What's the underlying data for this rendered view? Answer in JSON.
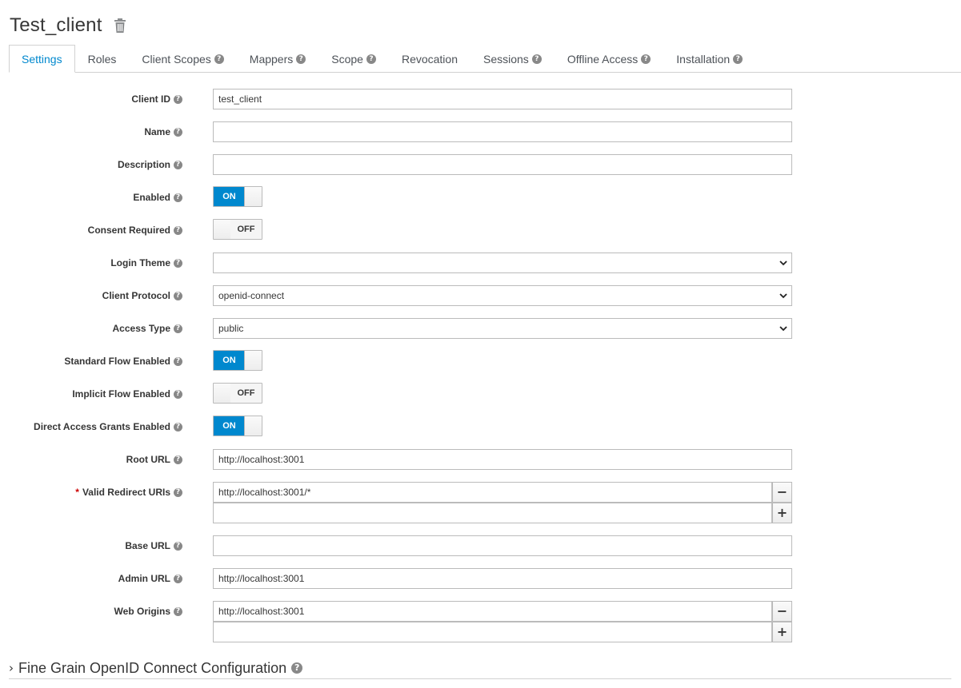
{
  "header": {
    "title": "Test_client",
    "delete_icon": "trash-icon"
  },
  "tabs": [
    {
      "label": "Settings",
      "help": false
    },
    {
      "label": "Roles",
      "help": false
    },
    {
      "label": "Client Scopes",
      "help": true
    },
    {
      "label": "Mappers",
      "help": true
    },
    {
      "label": "Scope",
      "help": true
    },
    {
      "label": "Revocation",
      "help": false
    },
    {
      "label": "Sessions",
      "help": true
    },
    {
      "label": "Offline Access",
      "help": true
    },
    {
      "label": "Installation",
      "help": true
    }
  ],
  "form": {
    "client_id": {
      "label": "Client ID",
      "value": "test_client"
    },
    "name": {
      "label": "Name",
      "value": ""
    },
    "description": {
      "label": "Description",
      "value": ""
    },
    "enabled": {
      "label": "Enabled",
      "state": "ON"
    },
    "consent_required": {
      "label": "Consent Required",
      "state": "OFF"
    },
    "login_theme": {
      "label": "Login Theme",
      "value": ""
    },
    "client_protocol": {
      "label": "Client Protocol",
      "value": "openid-connect"
    },
    "access_type": {
      "label": "Access Type",
      "value": "public"
    },
    "standard_flow": {
      "label": "Standard Flow Enabled",
      "state": "ON"
    },
    "implicit_flow": {
      "label": "Implicit Flow Enabled",
      "state": "OFF"
    },
    "direct_access": {
      "label": "Direct Access Grants Enabled",
      "state": "ON"
    },
    "root_url": {
      "label": "Root URL",
      "value": "http://localhost:3001"
    },
    "valid_redirect_uris": {
      "label": "Valid Redirect URIs",
      "required_mark": "*",
      "values": [
        "http://localhost:3001/*",
        ""
      ]
    },
    "base_url": {
      "label": "Base URL",
      "value": ""
    },
    "admin_url": {
      "label": "Admin URL",
      "value": "http://localhost:3001"
    },
    "web_origins": {
      "label": "Web Origins",
      "values": [
        "http://localhost:3001",
        ""
      ]
    }
  },
  "buttons": {
    "remove": "−",
    "add": "+"
  },
  "switch_labels": {
    "on": "ON",
    "off": "OFF"
  },
  "help_glyph": "?",
  "fine_grain": {
    "arrow": "›",
    "label": "Fine Grain OpenID Connect Configuration"
  },
  "colors": {
    "accent": "#0088ce",
    "required": "#cc0000"
  }
}
